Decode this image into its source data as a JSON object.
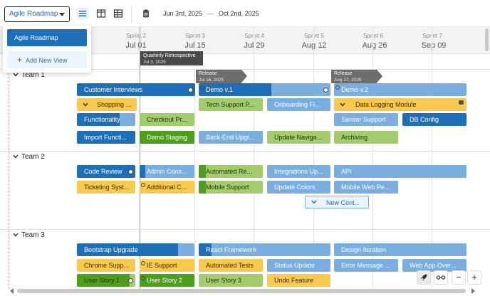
{
  "toolbar": {
    "view_selected": "Agile Roadmap",
    "date_start": "Jun 3rd, 2025",
    "date_sep": "—",
    "date_end": "Oct 2nd, 2025"
  },
  "menu": {
    "item": "Agile Roadmap",
    "add_new": "Add New View"
  },
  "timeline": {
    "sprints": [
      {
        "name": "Sprint 2",
        "date": "Jul 01"
      },
      {
        "name": "Sprint 3",
        "date": "Jul 15"
      },
      {
        "name": "Sprint 4",
        "date": "Jul 29"
      },
      {
        "name": "Sprint 5",
        "date": "Aug 12"
      },
      {
        "name": "Sprint 6",
        "date": "Aug 26"
      },
      {
        "name": "Sprint 7",
        "date": "Sep 09"
      }
    ]
  },
  "milestones": [
    {
      "title": "Quarterly Retrospective",
      "date": "Jul 3, 2025"
    },
    {
      "title": "Release",
      "date": "Jul 16, 2025"
    },
    {
      "title": "Release",
      "date": "Aug 17, 2025"
    }
  ],
  "teams": [
    {
      "name": "Team 1"
    },
    {
      "name": "Team 2"
    },
    {
      "name": "Team 3"
    }
  ],
  "bars": {
    "t1": [
      "Customer Interviews",
      "Demo v.1",
      "Demo v.2",
      "Shopping Cart",
      "Tech Support P...",
      "Onboarding Fl...",
      "Data Logging Module",
      "Functionality",
      "Checkout Pr...",
      "Sensor Support",
      "DB Config",
      "Import Functi...",
      "Demo Staging",
      "Back-End Upgr...",
      "Update Naviga...",
      "Archiving"
    ],
    "t2": [
      "Code Review",
      "Admin Cons...",
      "Automated Re...",
      "Integrations Up...",
      "API",
      "Ticketing Syst...",
      "Additional C...",
      "Mobile Support",
      "Update Colors",
      "Mobile Web Pe...",
      "New Cont..."
    ],
    "t3": [
      "Bootstrap Upgrade",
      "React Framework",
      "Design Iteration",
      "Chrome Supp...",
      "IE Support",
      "Automated Tests",
      "Status Update",
      "Error Message ...",
      "Web App Over...",
      "User Story 1",
      "User Story 2",
      "User Story 3",
      "Undo Feature"
    ]
  },
  "controls": {
    "zoom_out": "−",
    "zoom_in": "+"
  }
}
